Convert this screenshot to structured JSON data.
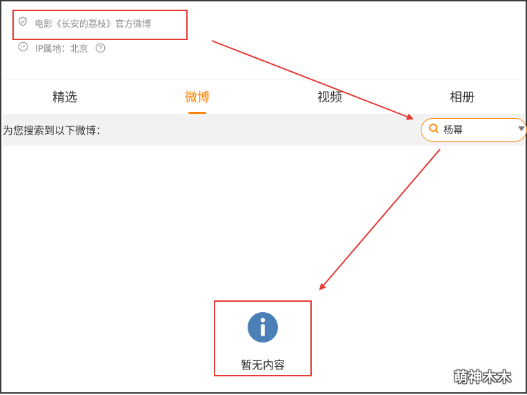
{
  "profile": {
    "verified_label": "电影《长安的荔枝》官方微博",
    "ip_location": "IP属地：北京",
    "verified_icon": "shield-check-icon",
    "ip_icon": "ip-icon",
    "help_icon": "question-circle-icon"
  },
  "tabs": [
    {
      "label": "精选",
      "active": false
    },
    {
      "label": "微博",
      "active": true
    },
    {
      "label": "视频",
      "active": false
    },
    {
      "label": "相册",
      "active": false
    }
  ],
  "search": {
    "result_label": "为您搜索到以下微博：",
    "query": "杨幂",
    "search_icon": "search-icon",
    "dropdown_icon": "caret-down-icon"
  },
  "empty_state": {
    "icon": "info-icon",
    "message": "暂无内容"
  },
  "watermark": "萌神木木",
  "colors": {
    "accent": "#ff8200",
    "annotation": "#e53935",
    "info_icon": "#4a7fb8",
    "toolbar_bg": "#f2f2f2"
  }
}
